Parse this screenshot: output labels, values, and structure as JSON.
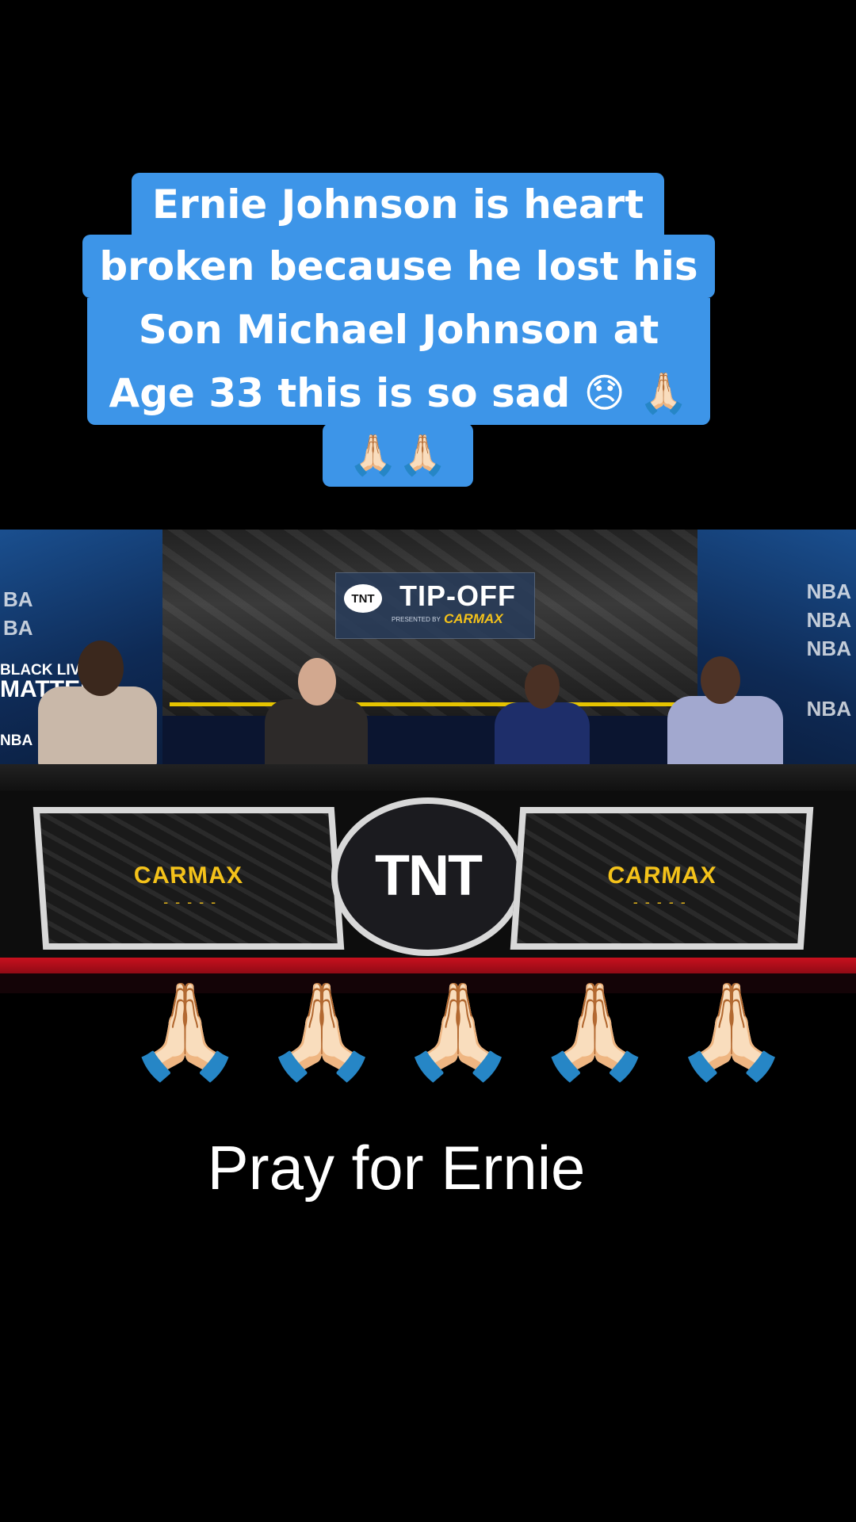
{
  "caption": {
    "lines": [
      "Ernie Johnson is heart",
      "broken because he lost his",
      "Son Michael Johnson at",
      "Age 33 this is so sad 😞 🙏🏻",
      "🙏🏻🙏🏻"
    ],
    "background_color": "#3d95e8",
    "text_color": "#ffffff"
  },
  "video": {
    "show_title": "TIP-OFF",
    "network_badge": "TNT",
    "presented_by": "PRESENTED BY",
    "sponsor_top": "CARMAX",
    "wall_left": [
      "BA",
      "BA",
      "BLACK LIVES",
      "MATTER",
      "NBA"
    ],
    "wall_right": [
      "NBA",
      "NBA",
      "NBA",
      "NBA"
    ],
    "desk_left_sponsor": "CARMAX",
    "desk_right_sponsor": "CARMAX",
    "desk_center_logo": "TNT",
    "dashes": "- - - - -"
  },
  "prayer_emojis": [
    "🙏🏻",
    "🙏🏻",
    "🙏🏻",
    "🙏🏻",
    "🙏🏻"
  ],
  "footer_text": "Pray for Ernie"
}
